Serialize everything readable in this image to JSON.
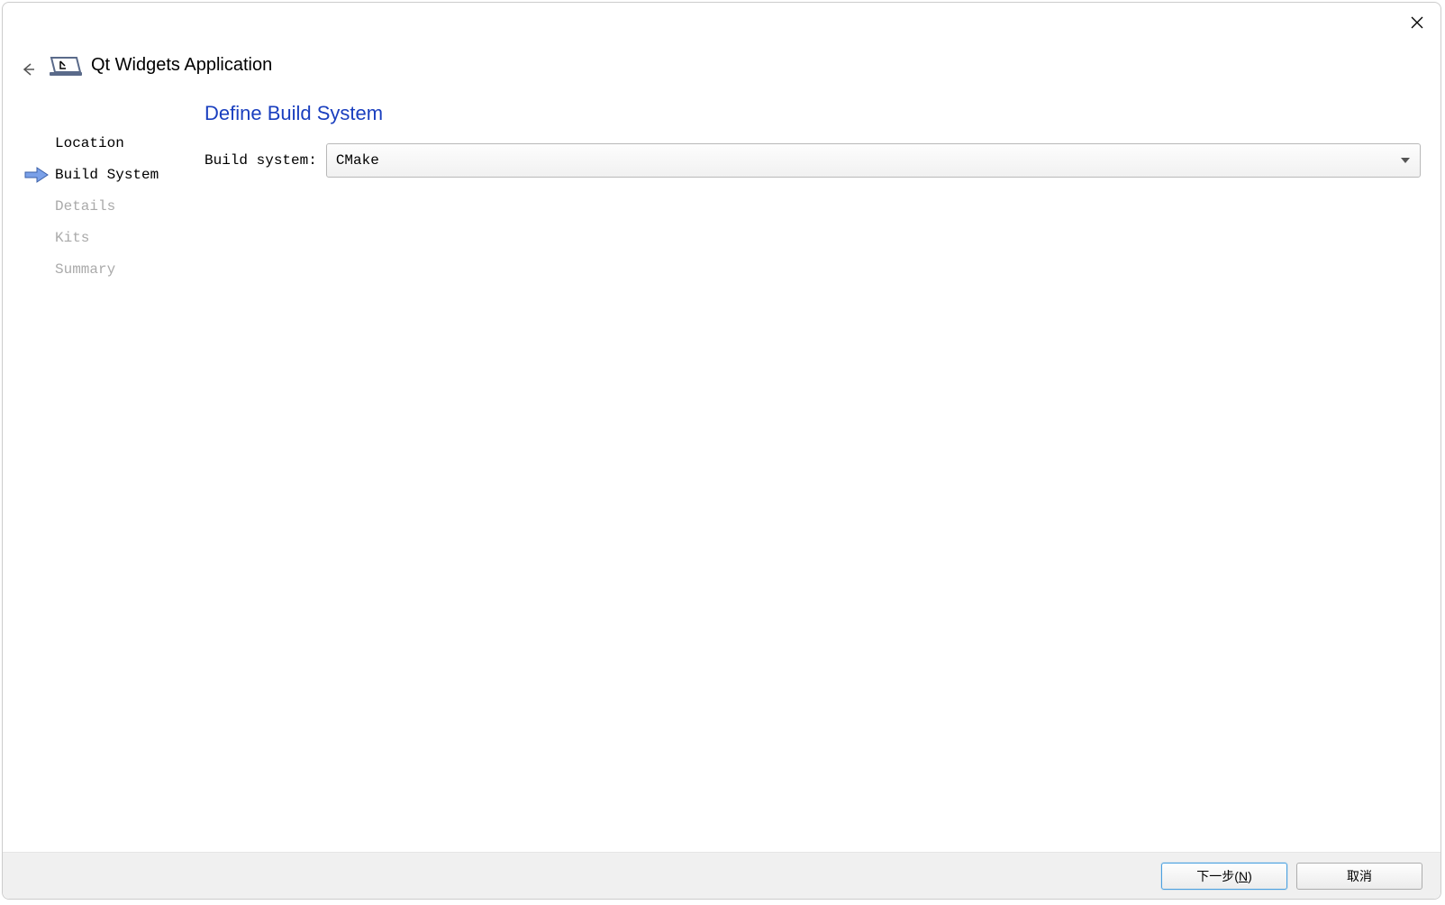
{
  "header": {
    "title": "Qt Widgets Application"
  },
  "steps": [
    {
      "label": "Location",
      "state": "done"
    },
    {
      "label": "Build System",
      "state": "current"
    },
    {
      "label": "Details",
      "state": "pending"
    },
    {
      "label": "Kits",
      "state": "pending"
    },
    {
      "label": "Summary",
      "state": "pending"
    }
  ],
  "main": {
    "heading": "Define Build System",
    "build_system_label": "Build system:",
    "build_system_value": "CMake"
  },
  "footer": {
    "next_label_prefix": "下一步(",
    "next_label_hotkey": "N",
    "next_label_suffix": ")",
    "cancel_label": "取消"
  }
}
